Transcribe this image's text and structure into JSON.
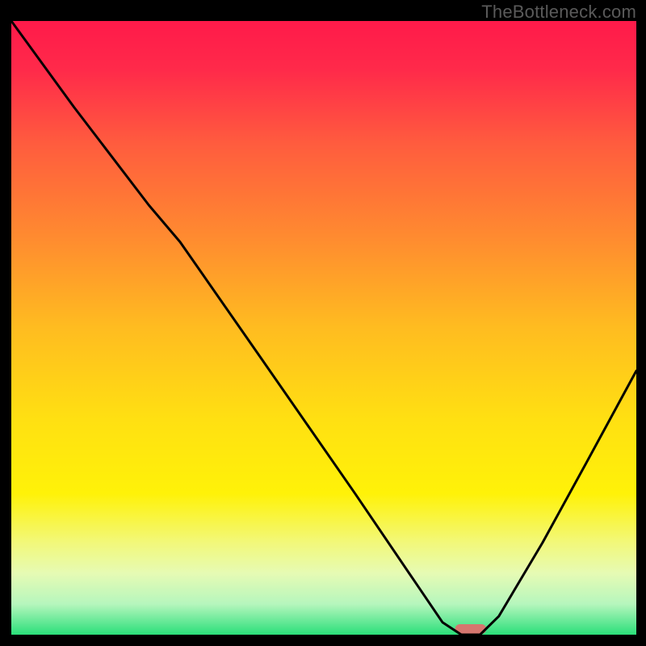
{
  "watermark": "TheBottleneck.com",
  "chart_data": {
    "type": "line",
    "title": "",
    "xlabel": "",
    "ylabel": "",
    "xlim": [
      0,
      100
    ],
    "ylim": [
      0,
      100
    ],
    "grid": false,
    "legend": false,
    "series": [
      {
        "name": "curve",
        "x": [
          0,
          10,
          22,
          27,
          40,
          55,
          65,
          69,
          72,
          75,
          78,
          85,
          92,
          100
        ],
        "y": [
          100,
          86,
          70,
          64,
          45,
          23,
          8,
          2,
          0,
          0,
          3,
          15,
          28,
          43
        ]
      }
    ],
    "marker": {
      "x": 73.5,
      "y": 0,
      "width_pct": 5.0,
      "color": "#d6766f"
    },
    "background_gradient": {
      "stops": [
        {
          "pct": 0,
          "color": "#ff1a4a"
        },
        {
          "pct": 8,
          "color": "#ff2a4a"
        },
        {
          "pct": 20,
          "color": "#ff5c3e"
        },
        {
          "pct": 35,
          "color": "#ff8a30"
        },
        {
          "pct": 50,
          "color": "#ffbc20"
        },
        {
          "pct": 65,
          "color": "#ffe012"
        },
        {
          "pct": 77,
          "color": "#fff208"
        },
        {
          "pct": 85,
          "color": "#f2f87a"
        },
        {
          "pct": 90,
          "color": "#e6fbb4"
        },
        {
          "pct": 95,
          "color": "#b6f6bd"
        },
        {
          "pct": 100,
          "color": "#2adf7a"
        }
      ]
    }
  }
}
